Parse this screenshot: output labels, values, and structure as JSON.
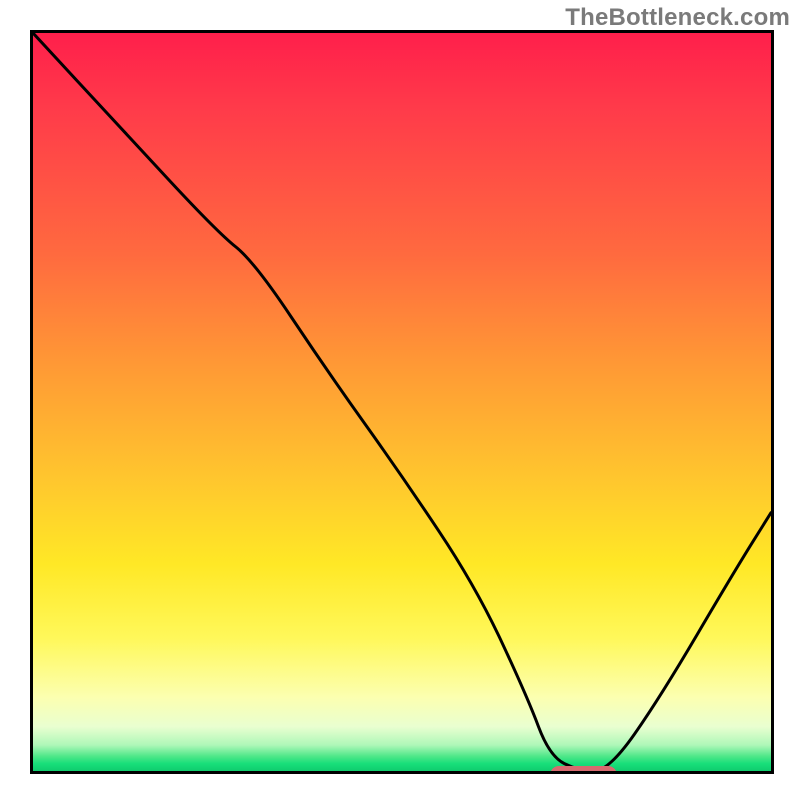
{
  "watermark": "TheBottleneck.com",
  "chart_data": {
    "type": "line",
    "title": "",
    "xlabel": "",
    "ylabel": "",
    "xlim": [
      0,
      100
    ],
    "ylim": [
      0,
      100
    ],
    "grid": false,
    "legend": false,
    "x": [
      0,
      12,
      25,
      30,
      40,
      50,
      60,
      67,
      70,
      74,
      78,
      85,
      95,
      100
    ],
    "values": [
      100,
      87,
      73,
      69,
      54,
      40,
      25,
      10,
      2,
      0,
      0,
      10,
      27,
      35
    ],
    "marker": {
      "x_start": 70,
      "x_end": 78,
      "y": 0
    },
    "colors": {
      "line": "#000000",
      "top": "#ff1f4b",
      "bottom": "#0fcc6e",
      "marker": "#d76a6f"
    }
  }
}
